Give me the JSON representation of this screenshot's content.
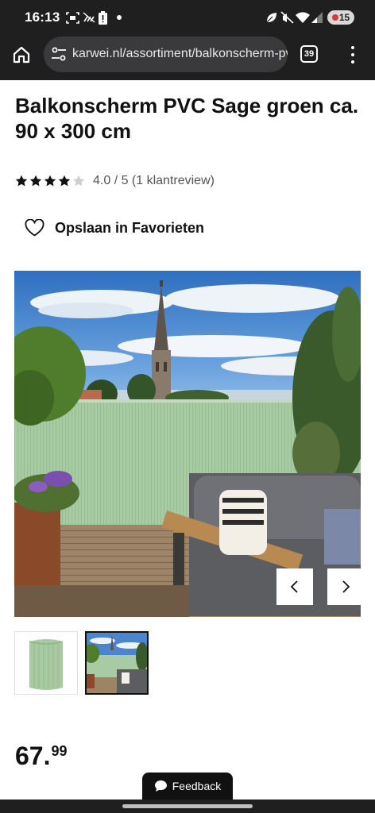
{
  "status_bar": {
    "time": "16:13",
    "battery": "15",
    "icons": [
      "screenshot-icon",
      "no-sim-icon",
      "battery-alert-icon",
      "dot-icon",
      "leaf-icon",
      "mute-icon",
      "wifi-icon",
      "signal-icon"
    ]
  },
  "browser": {
    "url": "karwei.nl/assortiment/balkonscherm-pvc",
    "tab_count": "39",
    "icons": [
      "home-icon",
      "site-settings-icon",
      "tabs-icon",
      "more-vert-icon"
    ]
  },
  "product": {
    "title": "Balkonscherm PVC Sage groen ca. 90 x 300 cm",
    "rating": 4,
    "rating_max": 5,
    "rating_text": "4.0 / 5 (1 klantreview)",
    "favorite_label": "Opslaan in Favorieten",
    "price_int": "67.",
    "price_dec": "99"
  },
  "gallery": {
    "active_index": 1,
    "thumbs": [
      "rolled-screen-thumbnail",
      "balcony-photo-thumbnail"
    ],
    "prev_icon": "chevron-left-icon",
    "next_icon": "chevron-right-icon"
  },
  "feedback_label": "Feedback",
  "colors": {
    "system_bar": "#1f1f1f",
    "url_pill": "#3a3a3c",
    "screen_green": "#a9cba4",
    "sky": "#3d7ec8",
    "text": "#111111",
    "star_empty": "#d0d0d0"
  }
}
